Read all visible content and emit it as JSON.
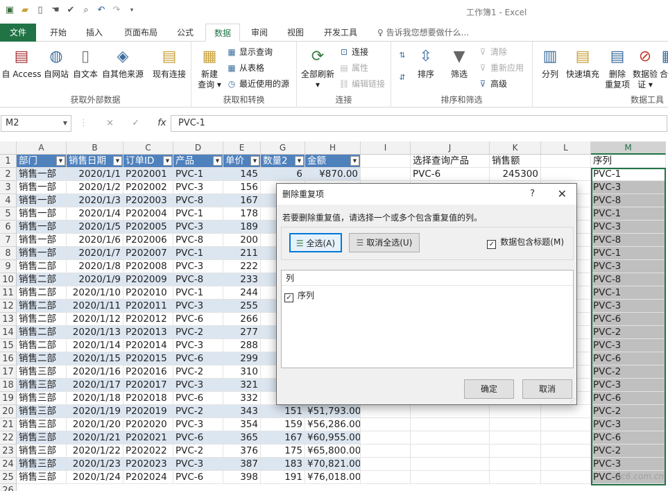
{
  "window": {
    "title": "工作簿1 - Excel"
  },
  "qat_icons": [
    "save-icon",
    "open-icon",
    "new-file-icon",
    "touch-mode-icon",
    "spell-check-icon",
    "print-preview-icon",
    "undo-icon",
    "redo-icon",
    "customize-icon"
  ],
  "tabs": [
    "文件",
    "开始",
    "插入",
    "页面布局",
    "公式",
    "数据",
    "审阅",
    "视图",
    "开发工具"
  ],
  "active_tab": "数据",
  "tell_me": "告诉我您想要做什么...",
  "ribbon": {
    "get_external": {
      "label": "获取外部数据",
      "btns": [
        "自 Access",
        "自网站",
        "自文本",
        "自其他来源",
        "现有连接"
      ]
    },
    "get_transform": {
      "label": "获取和转换",
      "new_query": "新建",
      "new_query2": "查询",
      "small": [
        "显示查询",
        "从表格",
        "最近使用的源"
      ]
    },
    "connections": {
      "label": "连接",
      "refresh_all": "全部刷新",
      "small": [
        "连接",
        "属性",
        "编辑链接"
      ]
    },
    "sort_filter": {
      "label": "排序和筛选",
      "sort": "排序",
      "filter": "筛选",
      "small": [
        "清除",
        "重新应用",
        "高级"
      ]
    },
    "data_tools": {
      "label": "数据工具",
      "btns": [
        "分列",
        "快速填充",
        "删除",
        "重复项",
        "数据验",
        "证",
        "合"
      ]
    }
  },
  "formula_bar": {
    "name_box": "M2",
    "formula": "PVC-1",
    "cancel": "×",
    "enter": "✓",
    "fx": "fx"
  },
  "col_headers": [
    "A",
    "B",
    "C",
    "D",
    "E",
    "G",
    "H",
    "I",
    "J",
    "K",
    "L",
    "M"
  ],
  "table_headers": [
    "部门",
    "销售日期",
    "订单ID",
    "产品",
    "单价",
    "数量2",
    "金额"
  ],
  "side_headers": {
    "j": "选择查询产品",
    "k": "销售额",
    "m": "序列"
  },
  "side_values": {
    "j2": "PVC-6",
    "k2": "245300"
  },
  "rows": [
    [
      "销售一部",
      "2020/1/1",
      "P202001",
      "PVC-1",
      "145",
      "6",
      "¥870.00",
      "PVC-1"
    ],
    [
      "销售一部",
      "2020/1/2",
      "P202002",
      "PVC-3",
      "156",
      "",
      "",
      "PVC-3"
    ],
    [
      "销售一部",
      "2020/1/3",
      "P202003",
      "PVC-8",
      "167",
      "",
      "",
      "PVC-8"
    ],
    [
      "销售一部",
      "2020/1/4",
      "P202004",
      "PVC-1",
      "178",
      "",
      "",
      "PVC-1"
    ],
    [
      "销售一部",
      "2020/1/5",
      "P202005",
      "PVC-3",
      "189",
      "",
      "",
      "PVC-3"
    ],
    [
      "销售一部",
      "2020/1/6",
      "P202006",
      "PVC-8",
      "200",
      "",
      "",
      "PVC-8"
    ],
    [
      "销售一部",
      "2020/1/7",
      "P202007",
      "PVC-1",
      "211",
      "",
      "",
      "PVC-1"
    ],
    [
      "销售二部",
      "2020/1/8",
      "P202008",
      "PVC-3",
      "222",
      "",
      "",
      "PVC-3"
    ],
    [
      "销售二部",
      "2020/1/9",
      "P202009",
      "PVC-8",
      "233",
      "",
      "",
      "PVC-8"
    ],
    [
      "销售二部",
      "2020/1/10",
      "P202010",
      "PVC-1",
      "244",
      "",
      "",
      "PVC-1"
    ],
    [
      "销售二部",
      "2020/1/11",
      "P202011",
      "PVC-3",
      "255",
      "",
      "",
      "PVC-3"
    ],
    [
      "销售二部",
      "2020/1/12",
      "P202012",
      "PVC-6",
      "266",
      "",
      "",
      "PVC-6"
    ],
    [
      "销售二部",
      "2020/1/13",
      "P202013",
      "PVC-2",
      "277",
      "",
      "",
      "PVC-2"
    ],
    [
      "销售二部",
      "2020/1/14",
      "P202014",
      "PVC-3",
      "288",
      "",
      "",
      "PVC-3"
    ],
    [
      "销售二部",
      "2020/1/15",
      "P202015",
      "PVC-6",
      "299",
      "",
      "",
      "PVC-6"
    ],
    [
      "销售三部",
      "2020/1/16",
      "P202016",
      "PVC-2",
      "310",
      "",
      "",
      "PVC-2"
    ],
    [
      "销售三部",
      "2020/1/17",
      "P202017",
      "PVC-3",
      "321",
      "",
      "",
      "PVC-3"
    ],
    [
      "销售三部",
      "2020/1/18",
      "P202018",
      "PVC-6",
      "332",
      "",
      "",
      "PVC-6"
    ],
    [
      "销售三部",
      "2020/1/19",
      "P202019",
      "PVC-2",
      "343",
      "151",
      "¥51,793.00",
      "PVC-2"
    ],
    [
      "销售三部",
      "2020/1/20",
      "P202020",
      "PVC-3",
      "354",
      "159",
      "¥56,286.00",
      "PVC-3"
    ],
    [
      "销售三部",
      "2020/1/21",
      "P202021",
      "PVC-6",
      "365",
      "167",
      "¥60,955.00",
      "PVC-6"
    ],
    [
      "销售三部",
      "2020/1/22",
      "P202022",
      "PVC-2",
      "376",
      "175",
      "¥65,800.00",
      "PVC-2"
    ],
    [
      "销售三部",
      "2020/1/23",
      "P202023",
      "PVC-3",
      "387",
      "183",
      "¥70,821.00",
      "PVC-3"
    ],
    [
      "销售三部",
      "2020/1/24",
      "P202024",
      "PVC-6",
      "398",
      "191",
      "¥76,018.00",
      "PVC-6"
    ]
  ],
  "dialog": {
    "title": "删除重复项",
    "help": "?",
    "close": "✕",
    "message": "若要删除重复值，请选择一个或多个包含重复值的列。",
    "select_all": "全选(A)",
    "unselect_all": "取消全选(U)",
    "has_headers": "数据包含标题(M)",
    "list_header": "列",
    "list_items": [
      "序列"
    ],
    "ok": "确定",
    "cancel": "取消"
  },
  "watermark": "pc6.com.cn",
  "colors": {
    "excel_green": "#217346",
    "table_header": "#4f81bd",
    "band": "#dce6f1"
  }
}
